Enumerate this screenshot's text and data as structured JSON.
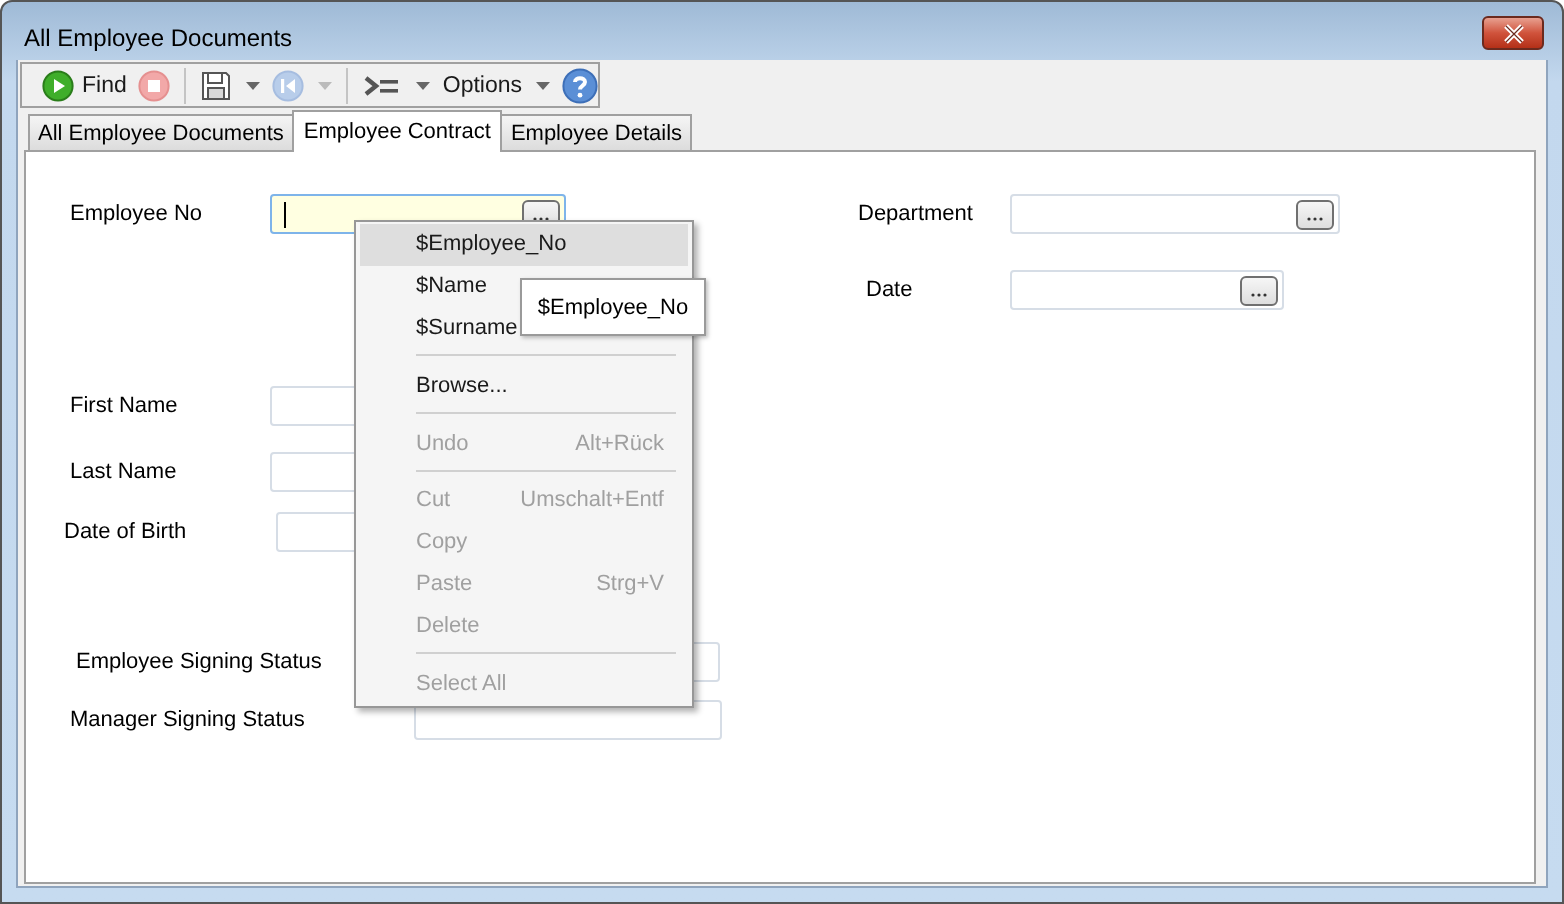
{
  "window": {
    "title": "All Employee Documents"
  },
  "toolbar": [
    {
      "kind": "play",
      "label": "Find"
    },
    {
      "kind": "stop",
      "disabled": true
    },
    {
      "kind": "separator"
    },
    {
      "kind": "save",
      "dropdown": true
    },
    {
      "kind": "rewind",
      "disabled": true,
      "dropdown": true
    },
    {
      "kind": "separator"
    },
    {
      "kind": "step",
      "dropdown": true
    },
    {
      "kind": "text",
      "label": "Options",
      "dropdown": true
    },
    {
      "kind": "help"
    }
  ],
  "tabs": [
    {
      "label": "All Employee Documents",
      "selected": false
    },
    {
      "label": "Employee Contract",
      "selected": true
    },
    {
      "label": "Employee Details",
      "selected": false
    }
  ],
  "form": {
    "left_column": [
      {
        "label": "Employee No",
        "browse": true,
        "focused": true
      },
      {
        "label": "First Name",
        "browse": false,
        "focused": false
      },
      {
        "label": "Last Name",
        "browse": false,
        "focused": false
      },
      {
        "label": "Date of Birth",
        "browse": false,
        "focused": false
      },
      {
        "label": "Employee Signing Status",
        "browse": false,
        "focused": false
      },
      {
        "label": "Manager Signing Status",
        "browse": false,
        "focused": false
      }
    ],
    "right_column": [
      {
        "label": "Department",
        "browse": true,
        "focused": false
      },
      {
        "label": "Date",
        "browse": true,
        "focused": false
      }
    ]
  },
  "context_menu": [
    {
      "kind": "item",
      "label": "$Employee_No",
      "selected": true,
      "disabled": false
    },
    {
      "kind": "item",
      "label": "$Name",
      "selected": false,
      "disabled": false
    },
    {
      "kind": "item",
      "label": "$Surname",
      "selected": false,
      "disabled": false
    },
    {
      "kind": "separator"
    },
    {
      "kind": "item",
      "label": "Browse...",
      "selected": false,
      "disabled": false
    },
    {
      "kind": "separator"
    },
    {
      "kind": "item",
      "label": "Undo",
      "shortcut": "Alt+Rück",
      "selected": false,
      "disabled": true
    },
    {
      "kind": "separator"
    },
    {
      "kind": "item",
      "label": "Cut",
      "shortcut": "Umschalt+Entf",
      "selected": false,
      "disabled": true
    },
    {
      "kind": "item",
      "label": "Copy",
      "selected": false,
      "disabled": true
    },
    {
      "kind": "item",
      "label": "Paste",
      "shortcut": "Strg+V",
      "selected": false,
      "disabled": true
    },
    {
      "kind": "item",
      "label": "Delete",
      "selected": false,
      "disabled": true
    },
    {
      "kind": "separator"
    },
    {
      "kind": "item",
      "label": "Select All",
      "selected": false,
      "disabled": true
    }
  ],
  "tooltip": {
    "text": "$Employee_No"
  }
}
